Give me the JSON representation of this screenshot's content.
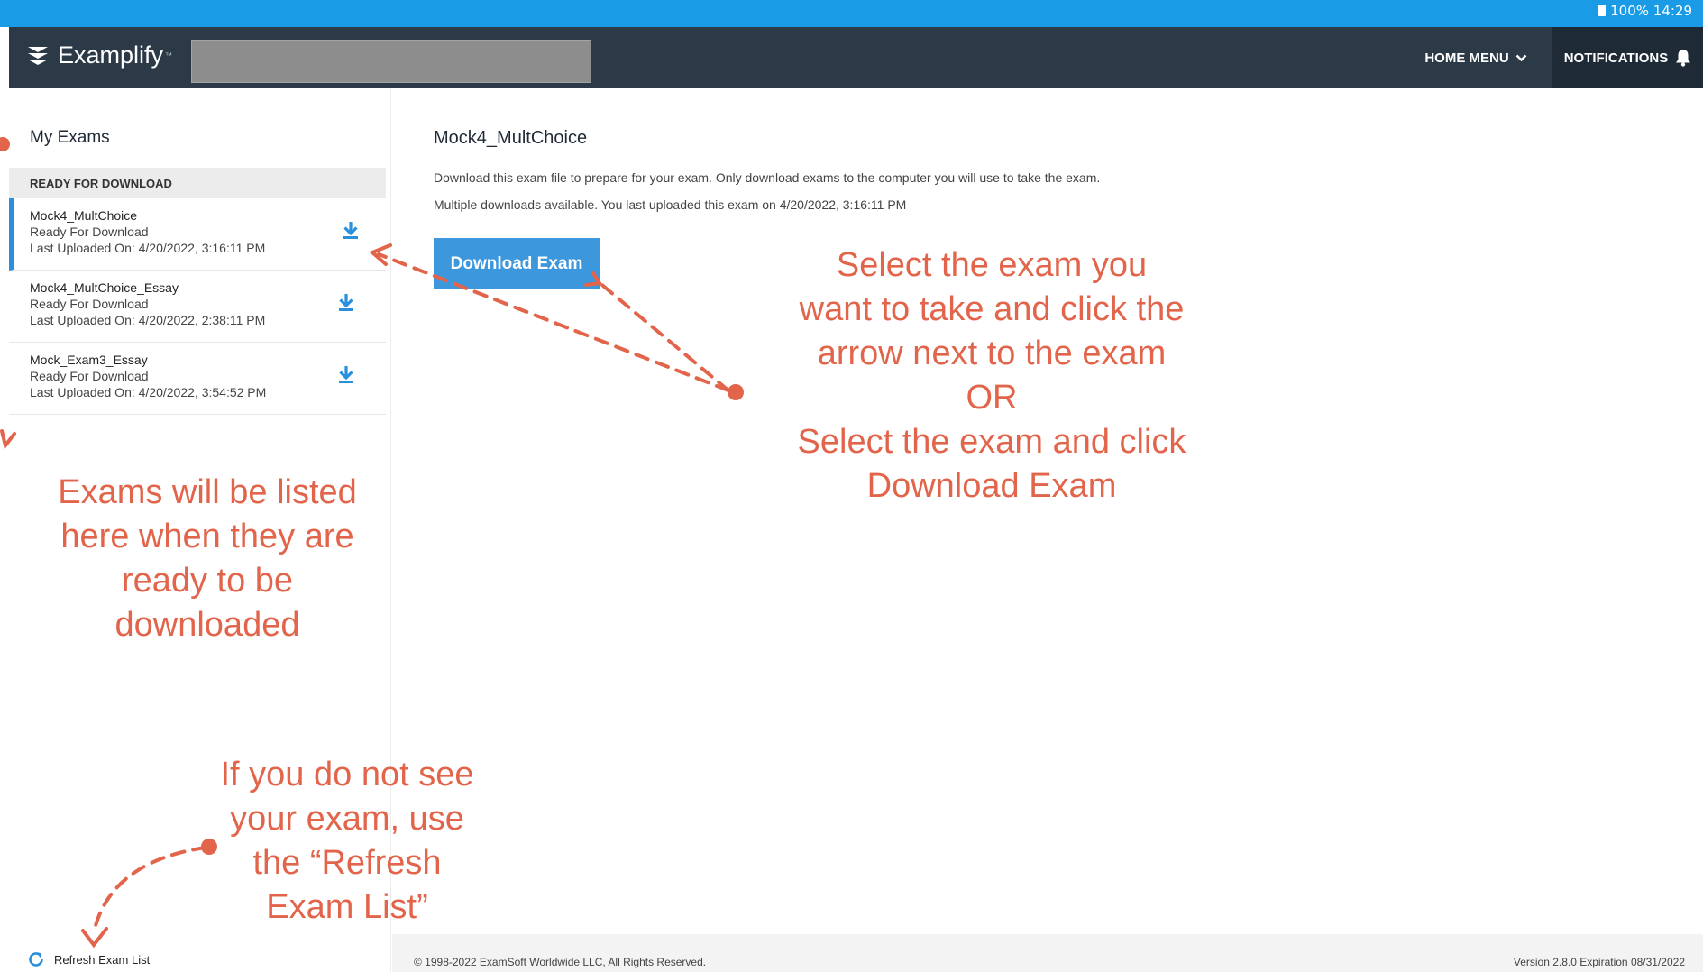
{
  "status_bar": {
    "text": "100% 14:29"
  },
  "header": {
    "app_name": "Examplify",
    "trademark": "™",
    "home_menu_label": "HOME MENU",
    "notifications_label": "NOTIFICATIONS"
  },
  "sidebar": {
    "title": "My Exams",
    "section_label": "READY FOR DOWNLOAD",
    "exams": [
      {
        "name": "Mock4_MultChoice",
        "status": "Ready For Download",
        "uploaded": "Last Uploaded On: 4/20/2022, 3:16:11 PM",
        "selected": true
      },
      {
        "name": "Mock4_MultChoice_Essay",
        "status": "Ready For Download",
        "uploaded": "Last Uploaded On: 4/20/2022, 2:38:11 PM",
        "selected": false
      },
      {
        "name": "Mock_Exam3_Essay",
        "status": "Ready For Download",
        "uploaded": "Last Uploaded On: 4/20/2022, 3:54:52 PM",
        "selected": false
      }
    ],
    "refresh_label": "Refresh Exam List"
  },
  "main": {
    "title": "Mock4_MultChoice",
    "description_line1": "Download this exam file to prepare for your exam. Only download exams to the computer you will use to take the exam.",
    "description_line2": "Multiple downloads available. You last uploaded this exam on 4/20/2022, 3:16:11 PM",
    "download_button": "Download Exam"
  },
  "footer": {
    "copyright": "© 1998-2022 ExamSoft Worldwide LLC, All Rights Reserved.",
    "version": "Version 2.8.0   Expiration 08/31/2022"
  },
  "annotations": {
    "select_exam": [
      "Select the exam you",
      "want to take and click the",
      "arrow next to the exam",
      "OR",
      "Select the exam and click",
      "Download Exam"
    ],
    "exams_listed": [
      "Exams will be listed",
      "here when they are",
      "ready to be",
      "downloaded"
    ],
    "refresh_hint": [
      "If you do not see",
      "your exam, use",
      "the “Refresh",
      "Exam List”"
    ]
  },
  "colors": {
    "status_bar": "#1a9be6",
    "header": "#2c3a47",
    "notifications_bg": "#1e2a36",
    "accent": "#2a90dc",
    "annotation": "#e2654b"
  },
  "icons": [
    "battery-icon",
    "examplify-logo-icon",
    "chevron-down-icon",
    "bell-icon",
    "download-arrow-icon",
    "refresh-icon"
  ]
}
